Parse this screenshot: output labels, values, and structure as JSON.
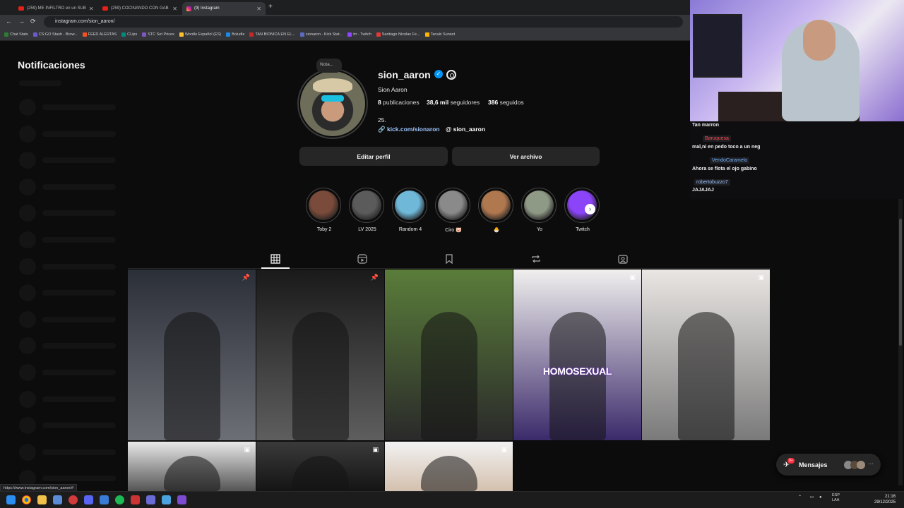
{
  "browser": {
    "tabs": [
      {
        "label": "(259) ME INFILTRO en un SUB"
      },
      {
        "label": "(259) COCINANDO CON GAB"
      },
      {
        "label": "(9) Instagram"
      }
    ],
    "new_tab": "+",
    "url": "instagram.com/sion_aaron/",
    "bookmarks": [
      "Chat Stats",
      "CS:GO Stash - Brow...",
      "FEED ALERTAS",
      "CLips",
      "STC Set Prices",
      "Wordle Español (ES)",
      "Boludle",
      "TAN BIONICA EN EL...",
      "sionaron - Kick Stat...",
      "trr - Twitch",
      "Santiago Nicolas Fe...",
      "Tanuki Sunset"
    ],
    "status_url": "https://www.instagram.com/sion_aaron/#"
  },
  "notifications": {
    "title": "Notificaciones"
  },
  "profile": {
    "note": "Nota...",
    "username": "sion_aaron",
    "full_name": "Sion Aaron",
    "posts_count": "8",
    "posts_label": "publicaciones",
    "followers_count": "38,6 mil",
    "followers_label": "seguidores",
    "following_count": "386",
    "following_label": "seguidos",
    "bio": "25.",
    "link": "kick.com/sionaron",
    "threads": "sion_aaron",
    "edit_button": "Editar perfil",
    "archive_button": "Ver archivo"
  },
  "highlights": [
    {
      "label": "Toby 2",
      "color": "#7a4b3a"
    },
    {
      "label": "LV 2025",
      "color": "#5b5b5b"
    },
    {
      "label": "Random 4",
      "color": "#6fb8d8"
    },
    {
      "label": "Ciro 🐷",
      "color": "#8a8a8a"
    },
    {
      "label": "🐣",
      "color": "#b0784f"
    },
    {
      "label": "Yo",
      "color": "#8f9a86"
    },
    {
      "label": "Twitch",
      "color": "#8b44f7"
    }
  ],
  "posts": [
    {
      "badge": "📌",
      "overlay": "",
      "colors": [
        "#2b2f38",
        "#6d6f76"
      ]
    },
    {
      "badge": "📌",
      "overlay": "",
      "colors": [
        "#1a1a1a",
        "#5e5e5e"
      ]
    },
    {
      "badge": "",
      "overlay": "",
      "colors": [
        "#5a7d3a",
        "#2a2a2a"
      ]
    },
    {
      "badge": "▣",
      "overlay": "HOMOSEXUAL",
      "colors": [
        "#f0efee",
        "#3b2a6a"
      ]
    },
    {
      "badge": "▣",
      "overlay": "",
      "colors": [
        "#e9e6e3",
        "#7a7a7a"
      ]
    },
    {
      "badge": "▣",
      "overlay": "",
      "colors": [
        "#e8e8e8",
        "#555"
      ]
    },
    {
      "badge": "▣",
      "overlay": "",
      "colors": [
        "#3a3a3a",
        "#141414"
      ]
    },
    {
      "badge": "▣",
      "overlay": "",
      "colors": [
        "#f2f2f2",
        "#d4c0ae"
      ]
    }
  ],
  "messages": {
    "label": "Mensajes",
    "badge": "9+"
  },
  "chat": {
    "messages": [
      {
        "user": "",
        "text": "Tan marron"
      },
      {
        "user": "Baruquesa",
        "text": "mal,ni en pedo toco a un neg"
      },
      {
        "user": "VendoCaramelo",
        "text": "Ahora se flota el ojo gabino"
      },
      {
        "user": "robertobuzzo7",
        "text": "JAJAJAJ"
      }
    ]
  },
  "taskbar": {
    "lang_top": "ESP",
    "lang_bottom": "LAA",
    "time": "21:16",
    "date": "29/12/2025"
  }
}
